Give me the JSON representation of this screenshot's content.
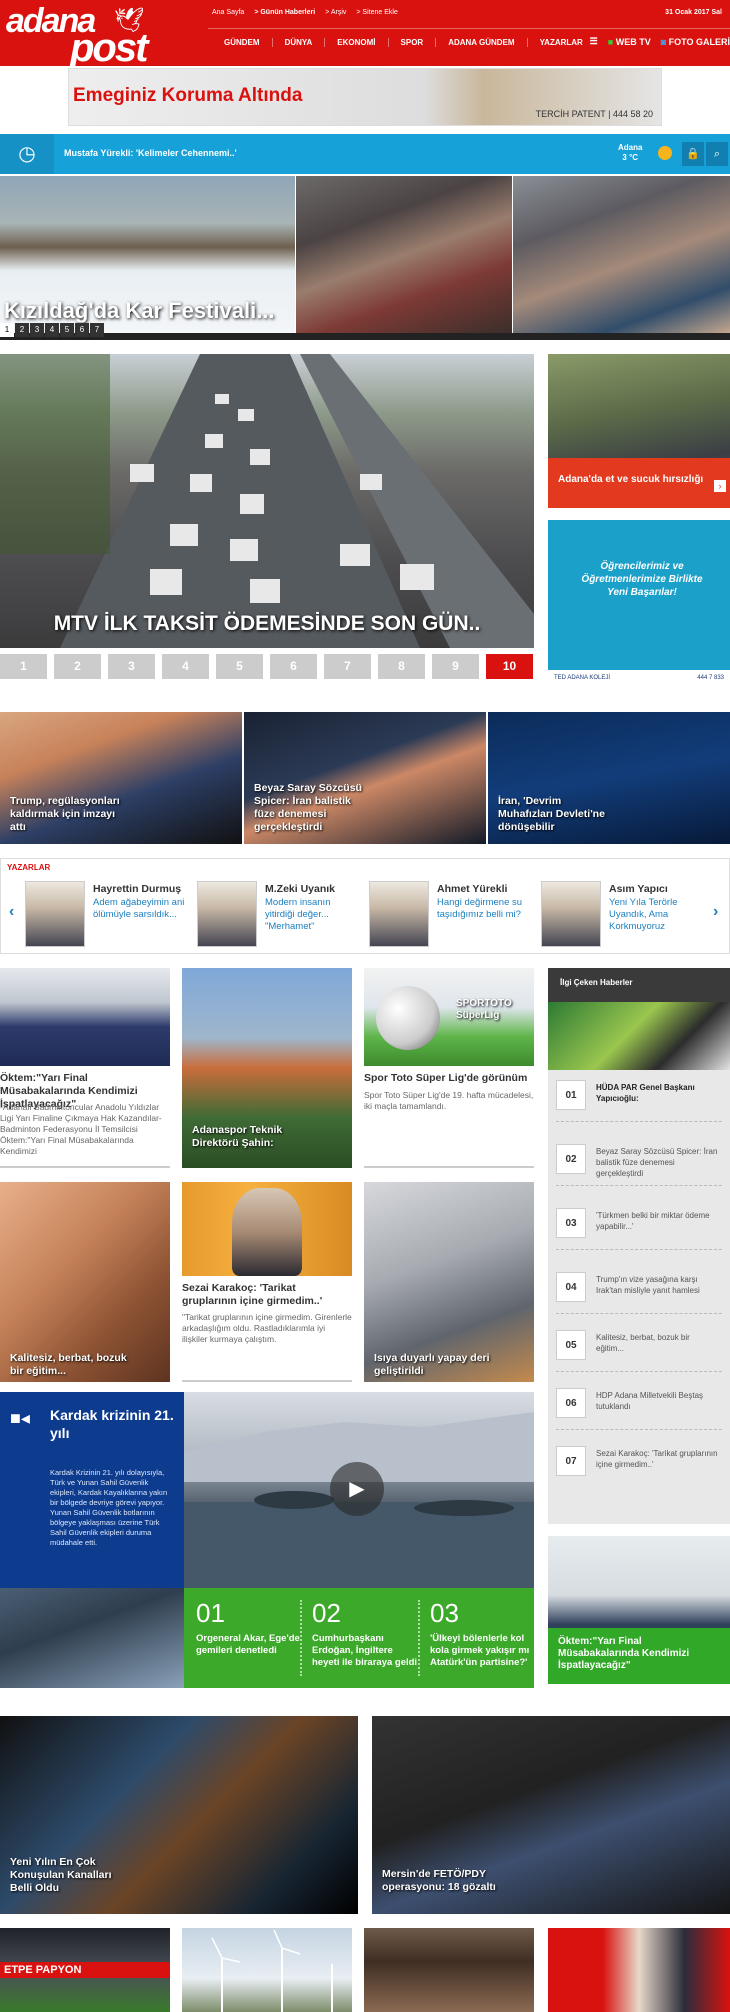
{
  "header": {
    "logo_top": "adana",
    "logo_bottom": "post",
    "toplinks": [
      "Ana Sayfa",
      "> Günün Haberleri",
      "> Arşiv",
      "> Sitene Ekle"
    ],
    "date": "31 Ocak 2017 Sal",
    "nav": [
      "GÜNDEM",
      "DÜNYA",
      "EKONOMİ",
      "SPOR",
      "ADANA GÜNDEM",
      "YAZARLAR"
    ],
    "webtv": "WEB TV",
    "foto": "FOTO GALERİ"
  },
  "ad": {
    "title": "Emeginiz Koruma Altında",
    "brand": "TERCİH PATENT | 444 58 20"
  },
  "ticker": {
    "text": "Mustafa Yürekli: 'Kelimeler Cehennemi..'",
    "city": "Adana",
    "temp": "3 °C"
  },
  "slider": {
    "caption": "Kızıldağ'da Kar Festivali...",
    "numbers": [
      "1",
      "2",
      "3",
      "4",
      "5",
      "6",
      "7"
    ]
  },
  "headline": {
    "caption": "MTV İLK TAKSİT ÖDEMESİNDE SON GÜN..",
    "pages": [
      "1",
      "2",
      "3",
      "4",
      "5",
      "6",
      "7",
      "8",
      "9",
      "10"
    ]
  },
  "side": {
    "item1": "Adana'da et ve sucuk hırsızlığı",
    "ad_text": "Öğrencilerimiz ve Öğretmenlerimize Birlikte Yeni Başarılar!",
    "ad_footer": "TED ADANA KOLEJİ",
    "ad_phone": "444 7 833"
  },
  "three": [
    {
      "caption": "Trump, regülasyonları kaldırmak için imzayı attı"
    },
    {
      "caption": "Beyaz Saray Sözcüsü Spicer: İran balistik füze denemesi gerçekleştirdi"
    },
    {
      "caption": "İran, 'Devrim Muhafızları Devleti'ne dönüşebilir"
    }
  ],
  "columnists": {
    "heading": "YAZARLAR",
    "items": [
      {
        "name": "Hayrettin Durmuş",
        "title": "Adem ağabeyimin ani ölümüyle sarsıldık..."
      },
      {
        "name": "M.Zeki Uyanık",
        "title": "Modern insanın yitirdiği değer... \"Merhamet\""
      },
      {
        "name": "Ahmet Yürekli",
        "title": "Hangi değirmene su taşıdığımız belli mi?"
      },
      {
        "name": "Asım Yapıcı",
        "title": "Yeni Yıla Terörle Uyandık, Ama Korkmuyoruz"
      }
    ]
  },
  "grid": {
    "c1_title": "Öktem:\"Yarı Final Müsabakalarında Kendimizi İspatlayacağız\"",
    "c1_ex": "-Adanalı Badmintoncular Anadolu Yıldızlar Ligi Yarı Finaline Çıkmaya Hak Kazandılar- Badminton Federasyonu İl Temsilcisi Öktem:\"Yarı Final Müsabakalarında Kendimizi",
    "c2_caption": "Adanaspor Teknik Direktörü Şahin:",
    "c3_title": "Spor Toto Süper Lig'de görünüm",
    "c3_ex": "Spor Toto Süper Lig'de 19. hafta mücadelesi, iki maçla tamamlandı.",
    "c3_logo_a": "SPORTOTO",
    "c3_logo_b": "SüperLig",
    "c4_caption": "Kalitesiz, berbat, bozuk bir eğitim...",
    "c5_title": "Sezai Karakoç: 'Tarikat gruplarının içine girmedim..'",
    "c5_ex": "\"Tarikat gruplarının içine girmedim. Girenlerle arkadaşlığım oldu. Rastladıklarımla iyi ilişkiler kurmaya çalıştım.",
    "c6_caption": "Isıya duyarlı yapay deri geliştirildi"
  },
  "popular": {
    "heading": "İlgi Çeken Haberler",
    "items": [
      {
        "n": "01",
        "t": "HÜDA PAR Genel Başkanı Yapıcıoğlu:"
      },
      {
        "n": "02",
        "t": "Beyaz Saray Sözcüsü Spicer: İran balistik füze denemesi gerçekleştirdi"
      },
      {
        "n": "03",
        "t": "'Türkmen belki bir miktar ödeme yapabilir...'"
      },
      {
        "n": "04",
        "t": "Trump'ın vize yasağına karşı Irak'tan misliyle yanıt hamlesi"
      },
      {
        "n": "05",
        "t": "Kalitesiz, berbat, bozuk bir eğitim..."
      },
      {
        "n": "06",
        "t": "HDP Adana Milletvekili Beştaş tutuklandı"
      },
      {
        "n": "07",
        "t": "Sezai Karakoç: 'Tarikat gruplarının içine girmedim..'"
      }
    ]
  },
  "kardak": {
    "title": "Kardak krizinin 21. yılı",
    "desc": "Kardak Krizinin 21. yılı dolayısıyla, Türk ve Yunan Sahil Güvenlik ekipleri, Kardak Kayalıklarına yakın bir bölgede devriye görevi yapıyor. Yunan Sahil Güvenlik botlarının bölgeye yaklaşması üzerine Türk Sahil Güvenlik ekipleri duruma müdahale etti.",
    "items": [
      {
        "n": "01",
        "t": "Orgeneral Akar, Ege'de gemileri denetledi"
      },
      {
        "n": "02",
        "t": "Cumhurbaşkanı Erdoğan, İngiltere heyeti ile biraraya geldi"
      },
      {
        "n": "03",
        "t": "'Ülkeyi bölenlerle kol kola girmek yakışır mı Atatürk'ün partisine?'"
      }
    ]
  },
  "side3": {
    "caption": "Öktem:\"Yarı Final Müsabakalarında Kendimizi İspatlayacağız\""
  },
  "bottom": {
    "b1": "Yeni Yılın En Çok Konuşulan Kanalları Belli Oldu",
    "b2": "Mersin'de FETÖ/PDY operasyonu: 18 gözaltı",
    "b3_banner": "ETPE PAPYON"
  }
}
